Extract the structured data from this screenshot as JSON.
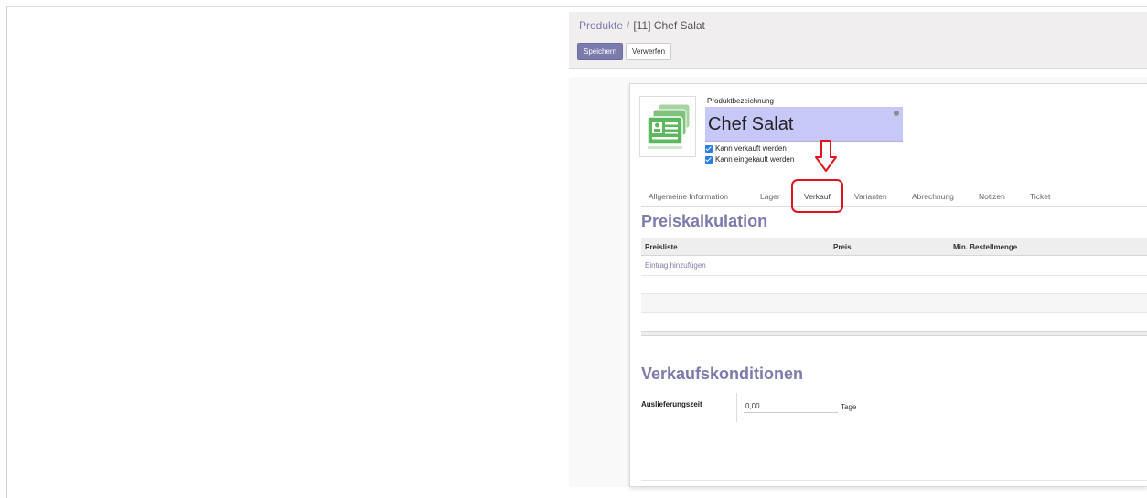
{
  "breadcrumb": {
    "parent": "Produkte",
    "separator": "/",
    "current": "[11] Chef Salat"
  },
  "buttons": {
    "save": "Speichern",
    "discard": "Verwerfen"
  },
  "product": {
    "name_label": "Produktbezeichnung",
    "name": "Chef Salat",
    "can_be_sold": {
      "label": "Kann verkauft werden",
      "checked": true
    },
    "can_be_purchased": {
      "label": "Kann eingekauft werden",
      "checked": true
    }
  },
  "tabs": [
    {
      "label": "Allgemeine Information"
    },
    {
      "label": "Lager"
    },
    {
      "label": "Verkauf",
      "active": true
    },
    {
      "label": "Varianten"
    },
    {
      "label": "Abrechnung"
    },
    {
      "label": "Notizen"
    },
    {
      "label": "Ticket"
    }
  ],
  "pricing": {
    "title": "Preiskalkulation",
    "columns": [
      "Preisliste",
      "Preis",
      "Min. Bestellmenge"
    ],
    "add_line": "Eintrag hinzufügen"
  },
  "sales_conditions": {
    "title": "Verkaufskonditionen",
    "lead_time_label": "Auslieferungszeit",
    "lead_time_value": "0,00",
    "lead_time_unit": "Tage"
  },
  "colors": {
    "accent": "#7c7bad",
    "name_field_bg": "#c8c8f8",
    "annotation": "#e0141e",
    "checkbox": "#2a7de1"
  },
  "icons": {
    "product_image": "contact-cards-icon",
    "translate": "globe-icon",
    "annotation_arrow": "arrow-down-icon"
  }
}
